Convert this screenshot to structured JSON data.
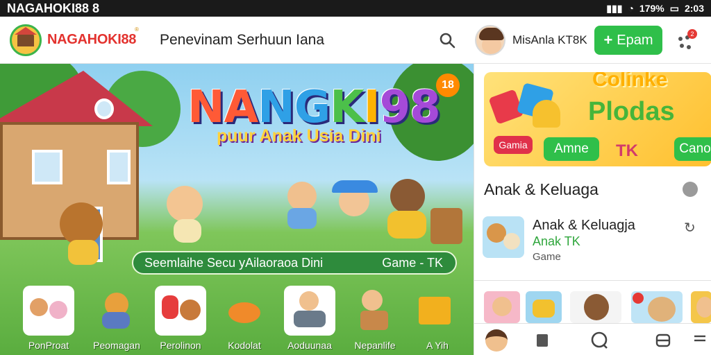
{
  "status_bar": {
    "app_label": "NAGAHOKI88 8",
    "battery_text": "179%",
    "time_text": "2:03"
  },
  "header": {
    "brand": "NAGAHOKI88",
    "brand_sup": "®",
    "title": "Penevinam Serhuun Iana",
    "user_name": "MisAnla KT8K",
    "cta_label": "Epam",
    "notification_count": "2"
  },
  "hero": {
    "title_letters": [
      "NA",
      "NG",
      "K",
      "I",
      "98"
    ],
    "subtitle": "puur Anak Usia Dini",
    "badge": "18",
    "banner_left": "Seemlaihe Secu yAilaoraoa Dini",
    "banner_right": "Game - TK",
    "categories": [
      {
        "label": "PonProat"
      },
      {
        "label": "Peomagan"
      },
      {
        "label": "Perolinon"
      },
      {
        "label": "Kodolat"
      },
      {
        "label": "Aoduunaa"
      },
      {
        "label": "Nepanlife"
      },
      {
        "label": "A Yih"
      }
    ]
  },
  "side": {
    "promo": {
      "line1": "Colinke",
      "line2": "Plodas",
      "pill_left": "Gamia",
      "pill_mid": "Amne",
      "tk": "TK",
      "pill_right": "Cano"
    },
    "section_title": "Anak & Keluaga",
    "app": {
      "name": "Anak & Keluagja",
      "category": "Anak TK",
      "type": "Game"
    }
  },
  "colors": {
    "accent": "#2fbf4a",
    "brand": "#e3322e"
  }
}
